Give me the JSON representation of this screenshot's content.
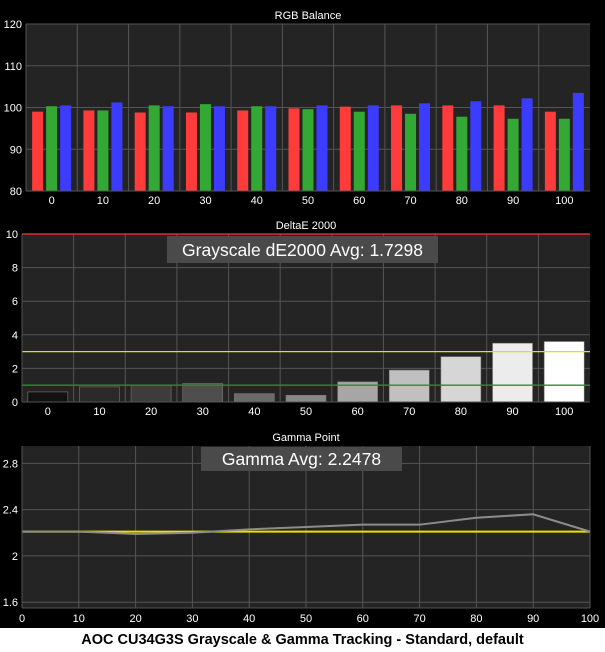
{
  "caption": "AOC CU34G3S Grayscale & Gamma Tracking - Standard, default",
  "colors": {
    "background": "#000000",
    "plot_bg": "#242424",
    "grid": "#555555",
    "text": "#ffffff",
    "red": "#ff3b3b",
    "green": "#34a834",
    "blue": "#3c3cff",
    "yellow": "#e8e000",
    "dark_green": "#2e8b2e",
    "top_line": "#ff3030",
    "gamma_line": "#8c8c8c"
  },
  "chart_data": [
    {
      "type": "bar",
      "title": "RGB Balance",
      "categories": [
        "0",
        "10",
        "20",
        "30",
        "40",
        "50",
        "60",
        "70",
        "80",
        "90",
        "100"
      ],
      "ylim": [
        80,
        120
      ],
      "yticks": [
        "80",
        "90",
        "100",
        "110",
        "120"
      ],
      "grid": true,
      "series": [
        {
          "values": [
            99,
            99.3,
            98.8,
            98.8,
            99.3,
            99.8,
            100.2,
            100.5,
            100.5,
            100.5,
            99
          ]
        },
        {
          "values": [
            100.3,
            99.3,
            100.5,
            100.8,
            100.3,
            99.6,
            99,
            98.5,
            97.8,
            97.3,
            97.3
          ]
        },
        {
          "values": [
            100.5,
            101.2,
            100.3,
            100.3,
            100.3,
            100.5,
            100.5,
            101,
            101.5,
            102.2,
            103.5
          ]
        }
      ]
    },
    {
      "type": "bar",
      "title": "DeltaE 2000",
      "annotation": "Grayscale dE2000 Avg: 1.7298",
      "categories": [
        "0",
        "10",
        "20",
        "30",
        "40",
        "50",
        "60",
        "70",
        "80",
        "90",
        "100"
      ],
      "values": [
        0.6,
        0.9,
        1.0,
        1.1,
        0.5,
        0.4,
        1.2,
        1.9,
        2.7,
        3.5,
        3.6
      ],
      "bar_shades": [
        "#111111",
        "#2a2a2a",
        "#3c3c3c",
        "#4e4e4e",
        "#6a6a6a",
        "#888888",
        "#a6a6a6",
        "#c0c0c0",
        "#d6d6d6",
        "#ececec",
        "#ffffff"
      ],
      "ylim": [
        0,
        10
      ],
      "yticks": [
        "0",
        "2",
        "4",
        "6",
        "8",
        "10"
      ],
      "reference_lines": [
        1,
        3,
        10
      ],
      "grid": true
    },
    {
      "type": "line",
      "title": "Gamma Point",
      "annotation": "Gamma Avg: 2.2478",
      "x": [
        0,
        10,
        20,
        30,
        40,
        50,
        60,
        70,
        80,
        90,
        100
      ],
      "xticks": [
        "0",
        "10",
        "20",
        "30",
        "40",
        "50",
        "60",
        "70",
        "80",
        "90",
        "100"
      ],
      "series": [
        {
          "values": [
            2.21,
            2.21,
            2.19,
            2.2,
            2.23,
            2.25,
            2.27,
            2.27,
            2.33,
            2.36,
            2.21
          ]
        }
      ],
      "target": 2.21,
      "ylim": [
        1.55,
        2.95
      ],
      "yticks": [
        "1.6",
        "2",
        "2.4",
        "2.8"
      ],
      "xlim": [
        0,
        100
      ],
      "grid": true
    }
  ]
}
